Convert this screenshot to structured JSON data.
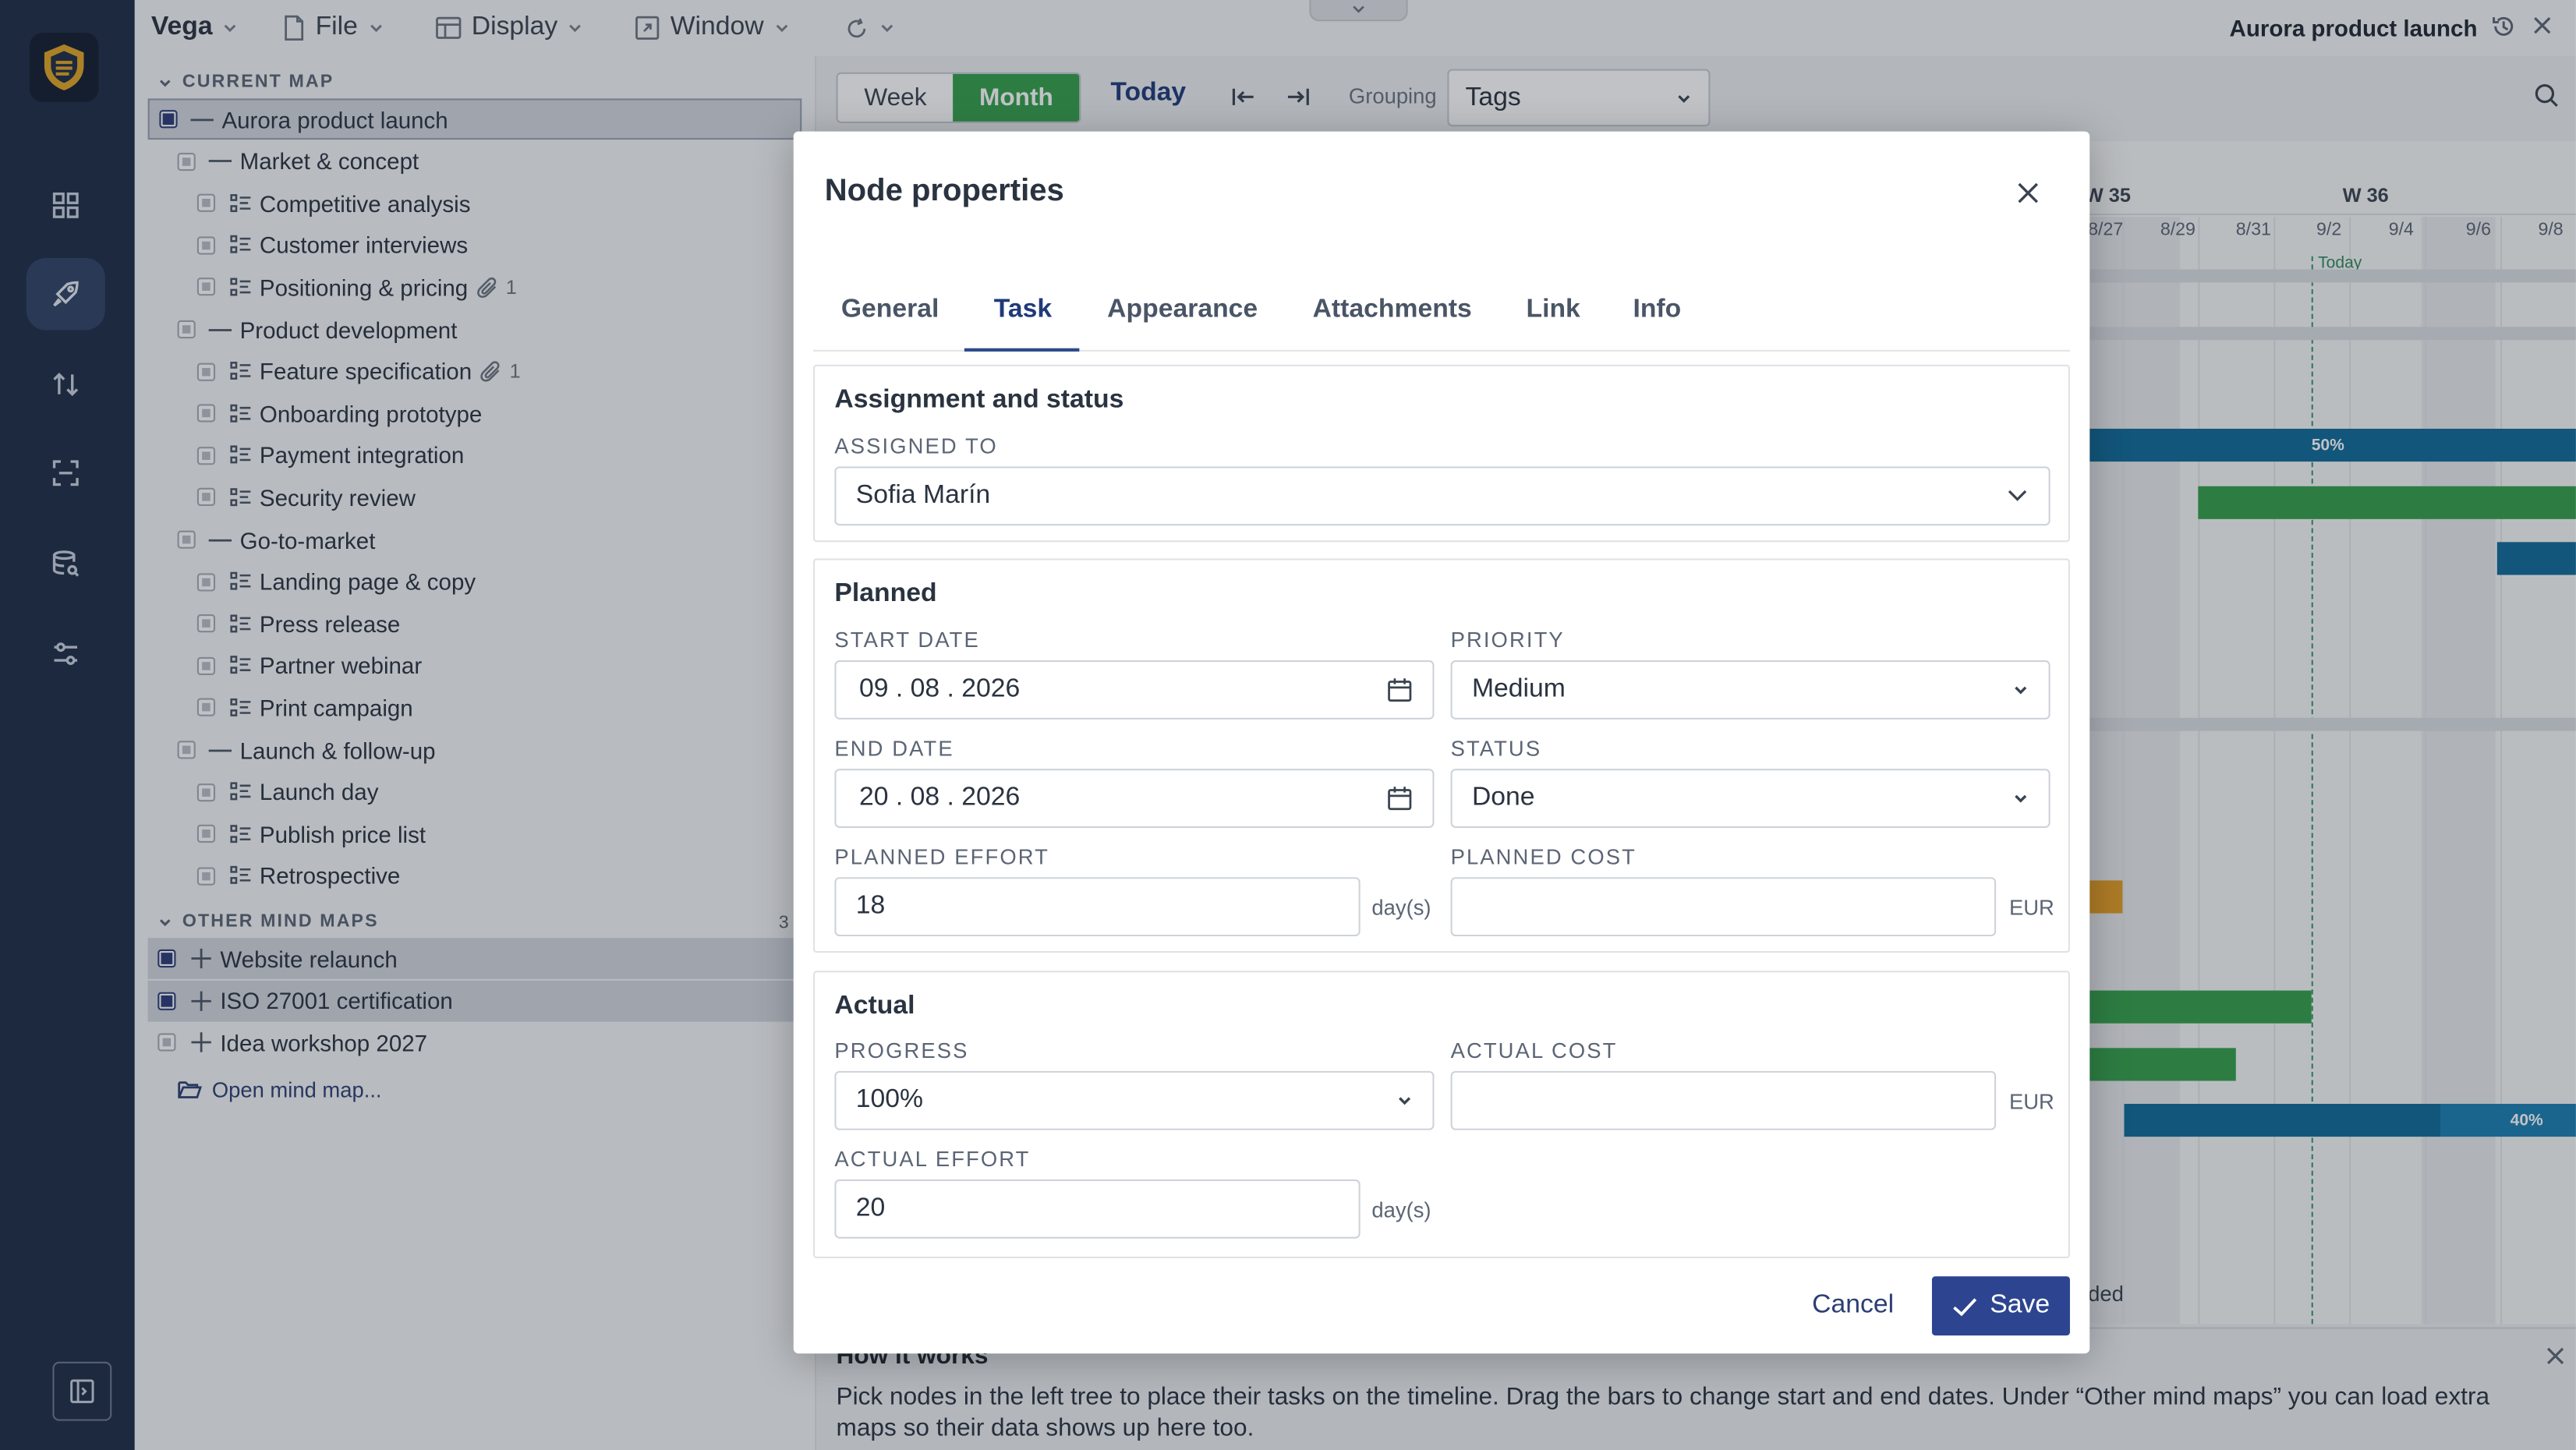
{
  "app": {
    "brand": "Vega",
    "menus": [
      "File",
      "Display",
      "Window"
    ],
    "document_title": "Aurora product launch"
  },
  "tree": {
    "current_map_header": "CURRENT MAP",
    "current_map": [
      {
        "label": "Aurora product launch",
        "level": 0,
        "kind": "root",
        "checked": true,
        "selected": true
      },
      {
        "label": "Market & concept",
        "level": 1,
        "kind": "group"
      },
      {
        "label": "Competitive analysis",
        "level": 2,
        "kind": "task"
      },
      {
        "label": "Customer interviews",
        "level": 2,
        "kind": "task"
      },
      {
        "label": "Positioning & pricing",
        "level": 2,
        "kind": "task",
        "attachments": "1"
      },
      {
        "label": "Product development",
        "level": 1,
        "kind": "group"
      },
      {
        "label": "Feature specification",
        "level": 2,
        "kind": "task",
        "attachments": "1"
      },
      {
        "label": "Onboarding prototype",
        "level": 2,
        "kind": "task"
      },
      {
        "label": "Payment integration",
        "level": 2,
        "kind": "task"
      },
      {
        "label": "Security review",
        "level": 2,
        "kind": "task"
      },
      {
        "label": "Go-to-market",
        "level": 1,
        "kind": "group"
      },
      {
        "label": "Landing page & copy",
        "level": 2,
        "kind": "task"
      },
      {
        "label": "Press release",
        "level": 2,
        "kind": "task"
      },
      {
        "label": "Partner webinar",
        "level": 2,
        "kind": "task"
      },
      {
        "label": "Print campaign",
        "level": 2,
        "kind": "task"
      },
      {
        "label": "Launch & follow-up",
        "level": 1,
        "kind": "group"
      },
      {
        "label": "Launch day",
        "level": 2,
        "kind": "task"
      },
      {
        "label": "Publish price list",
        "level": 2,
        "kind": "task"
      },
      {
        "label": "Retrospective",
        "level": 2,
        "kind": "task"
      }
    ],
    "other_maps_header": "OTHER MIND MAPS",
    "other_maps_count": "3",
    "other_maps": [
      {
        "label": "Website relaunch",
        "checked": true,
        "selected": true
      },
      {
        "label": "ISO 27001 certification",
        "checked": true,
        "selected": true
      },
      {
        "label": "Idea workshop 2027",
        "checked": false,
        "selected": false
      }
    ],
    "open_mind_map": "Open mind map..."
  },
  "toolbar": {
    "week": "Week",
    "month": "Month",
    "today": "Today",
    "grouping_label": "Grouping",
    "grouping_value": "Tags"
  },
  "gantt": {
    "weeks": [
      "W 35",
      "W 36"
    ],
    "days": [
      "8/27",
      "8/29",
      "8/31",
      "9/2",
      "9/4",
      "9/6",
      "9/8"
    ],
    "today_label": "Today",
    "bar_labels": [
      "50%",
      "40%"
    ],
    "ended_fragment": "ded"
  },
  "how_it_works": {
    "title": "How it works",
    "text": "Pick nodes in the left tree to place their tasks on the timeline. Drag the bars to change start and end dates. Under “Other mind maps” you can load extra maps so their data shows up here too."
  },
  "modal": {
    "title": "Node properties",
    "tabs": [
      "General",
      "Task",
      "Appearance",
      "Attachments",
      "Link",
      "Info"
    ],
    "active_tab": "Task",
    "assignment": {
      "title": "Assignment and status",
      "assigned_to_label": "ASSIGNED TO",
      "assigned_to": "Sofia Marín"
    },
    "planned": {
      "title": "Planned",
      "start_label": "START DATE",
      "start_date": "09 . 08 . 2026",
      "priority_label": "PRIORITY",
      "priority": "Medium",
      "end_label": "END DATE",
      "end_date": "20 . 08 . 2026",
      "status_label": "STATUS",
      "status": "Done",
      "effort_label": "PLANNED EFFORT",
      "effort": "18",
      "effort_unit": "day(s)",
      "cost_label": "PLANNED COST",
      "cost": "",
      "cost_unit": "EUR"
    },
    "actual": {
      "title": "Actual",
      "progress_label": "PROGRESS",
      "progress": "100%",
      "cost_label": "ACTUAL COST",
      "cost": "",
      "cost_unit": "EUR",
      "effort_label": "ACTUAL EFFORT",
      "effort": "20",
      "effort_unit": "day(s)"
    },
    "cancel": "Cancel",
    "save": "Save"
  },
  "colors": {
    "rail": "#1e2b45",
    "accent_green": "#34a04c",
    "accent_blue": "#2d4590",
    "bar_blue": "#0e6a99"
  }
}
